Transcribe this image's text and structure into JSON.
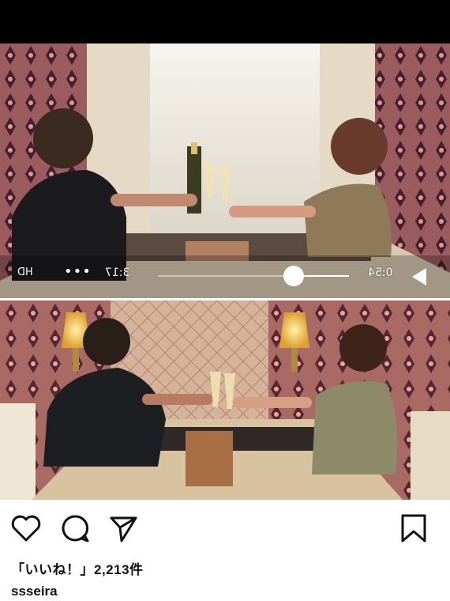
{
  "video": {
    "elapsed": "0:54",
    "total": "3:17",
    "more": "•••",
    "quality": "HD"
  },
  "post": {
    "likes_text": "「いいね！」2,213件",
    "username": "ssseira"
  },
  "icons": {
    "like": "heart-icon",
    "comment": "comment-icon",
    "share": "send-icon",
    "save": "bookmark-icon",
    "play": "play-icon"
  },
  "colors": {
    "wallpaper": "#7d3a45",
    "curtain": "#e9e2d4",
    "table": "#cdb89e",
    "text": "#111111"
  }
}
